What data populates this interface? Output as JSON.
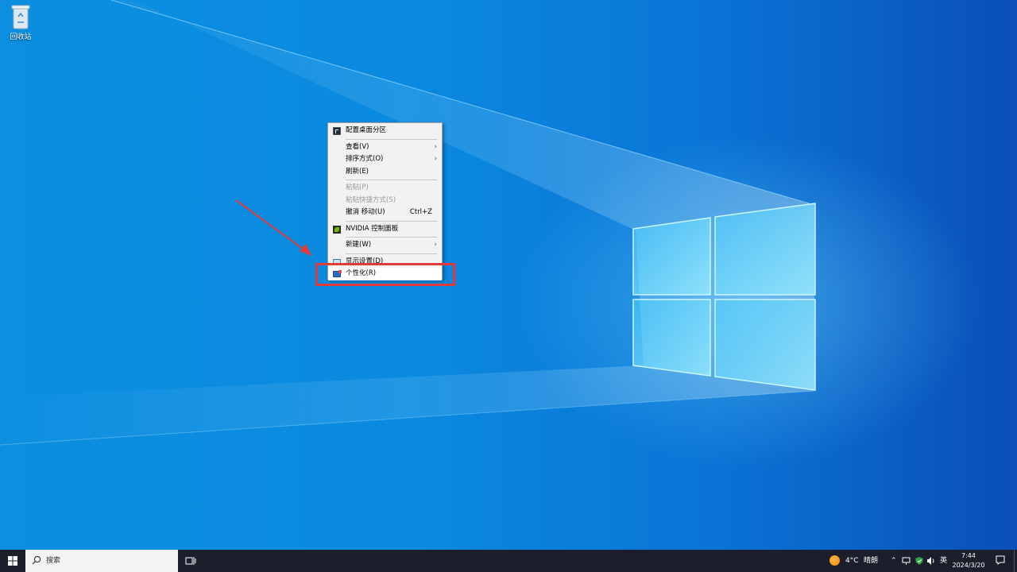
{
  "desktop": {
    "icons": [
      {
        "label": "回收站",
        "icon": "recycle-bin-icon"
      }
    ]
  },
  "context_menu": {
    "items": [
      {
        "id": "config",
        "label": "配置桌面分区",
        "icon": "desktop-partition-icon"
      },
      {
        "id": "view",
        "label": "查看(V)",
        "submenu": true
      },
      {
        "id": "sort",
        "label": "排序方式(O)",
        "submenu": true
      },
      {
        "id": "refresh",
        "label": "刷新(E)"
      },
      {
        "id": "paste",
        "label": "粘贴(P)",
        "disabled": true
      },
      {
        "id": "paste_shortcut",
        "label": "粘贴快捷方式(S)",
        "disabled": true
      },
      {
        "id": "undo",
        "label": "撤消 移动(U)",
        "shortcut": "Ctrl+Z"
      },
      {
        "id": "nvidia",
        "label": "NVIDIA 控制面板",
        "icon": "nvidia-icon"
      },
      {
        "id": "new",
        "label": "新建(W)",
        "submenu": true
      },
      {
        "id": "display",
        "label": "显示设置(D)",
        "icon": "display-icon"
      },
      {
        "id": "personalize",
        "label": "个性化(R)",
        "icon": "personalize-icon",
        "highlighted": true
      }
    ]
  },
  "annotation": {
    "color": "#e03a3a"
  },
  "taskbar": {
    "search_placeholder": "搜索",
    "weather": {
      "temp": "4°C",
      "condition": "晴朗"
    },
    "language": "英",
    "time": "7:44",
    "date": "2024/3/20"
  },
  "colors": {
    "taskbar_bg": "#1a1f2b",
    "wallpaper": "#0a8ae0",
    "accent": "#e03a3a"
  }
}
